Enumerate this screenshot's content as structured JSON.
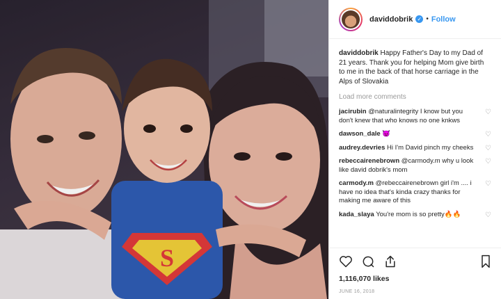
{
  "header": {
    "username": "daviddobrik",
    "separator": "•",
    "follow_label": "Follow"
  },
  "caption": {
    "username": "daviddobrik",
    "text": "Happy Father's Day to my Dad of 21 years. Thank you for helping Mom give birth to me in the back of that horse carriage in the Alps of Slovakia"
  },
  "load_more_label": "Load more comments",
  "comments": [
    {
      "username": "jacirubin",
      "text": "@naturalintegrity I know but you don't knew that who knows no one knkws"
    },
    {
      "username": "dawson_dale",
      "text": "😈"
    },
    {
      "username": "audrey.devries",
      "text": "Hi I'm David pinch my cheeks"
    },
    {
      "username": "rebeccairenebrown",
      "text": "@carmody.m why u look like david dobrik's mom"
    },
    {
      "username": "carmody.m",
      "text": "@rebeccairenebrown girl i'm .... i have no idea that's kinda crazy thanks for making me aware of this"
    },
    {
      "username": "kada_slaya",
      "text": "You're mom is so pretty🔥🔥"
    }
  ],
  "likes": "1,116,070 likes",
  "date": "JUNE 16, 2018",
  "icons": {
    "like": "heart-icon",
    "comment": "comment-icon",
    "share": "share-icon",
    "save": "bookmark-icon",
    "verified": "verified-badge-icon"
  },
  "colors": {
    "link": "#3897f0",
    "muted": "#999999",
    "text": "#262626"
  }
}
